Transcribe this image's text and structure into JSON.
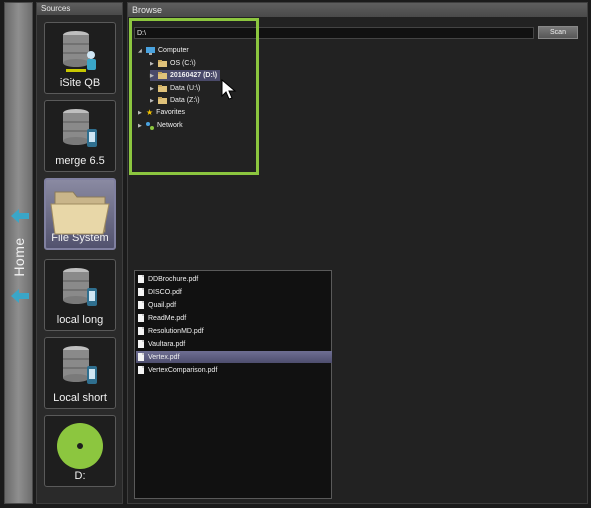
{
  "home": {
    "label": "Home"
  },
  "sources": {
    "title": "Sources",
    "items": [
      {
        "label": "iSite QB",
        "icon": "database-server-icon"
      },
      {
        "label": "merge 6.5",
        "icon": "database-server-icon"
      },
      {
        "label": "File System",
        "icon": "folder-icon",
        "active": true
      },
      {
        "label": "local long",
        "icon": "database-server-icon"
      },
      {
        "label": "Local short",
        "icon": "database-server-icon"
      },
      {
        "label": "D:",
        "icon": "disc-icon"
      }
    ]
  },
  "browse": {
    "title": "Browse",
    "path_value": "D:\\",
    "scan_label": "Scan",
    "tree": [
      {
        "label": "Computer"
      },
      {
        "label": "OS (C:\\)"
      },
      {
        "label": "20160427 (D:\\)",
        "selected": true
      },
      {
        "label": "Data (U:\\)"
      },
      {
        "label": "Data (Z:\\)"
      },
      {
        "label": "Favorites"
      },
      {
        "label": "Network"
      }
    ],
    "files": [
      "DDBrochure.pdf",
      "DISCO.pdf",
      "Quail.pdf",
      "ReadMe.pdf",
      "ResolutionMD.pdf",
      "Vaultara.pdf",
      "Vertex.pdf",
      "VertexComparison.pdf"
    ],
    "selected_file": "Vertex.pdf"
  },
  "colors": {
    "highlight_green": "#8cc63f",
    "arrow_teal": "#3aa6c8",
    "disc_green": "#8cc63f",
    "selection": "#5a5a7e"
  }
}
